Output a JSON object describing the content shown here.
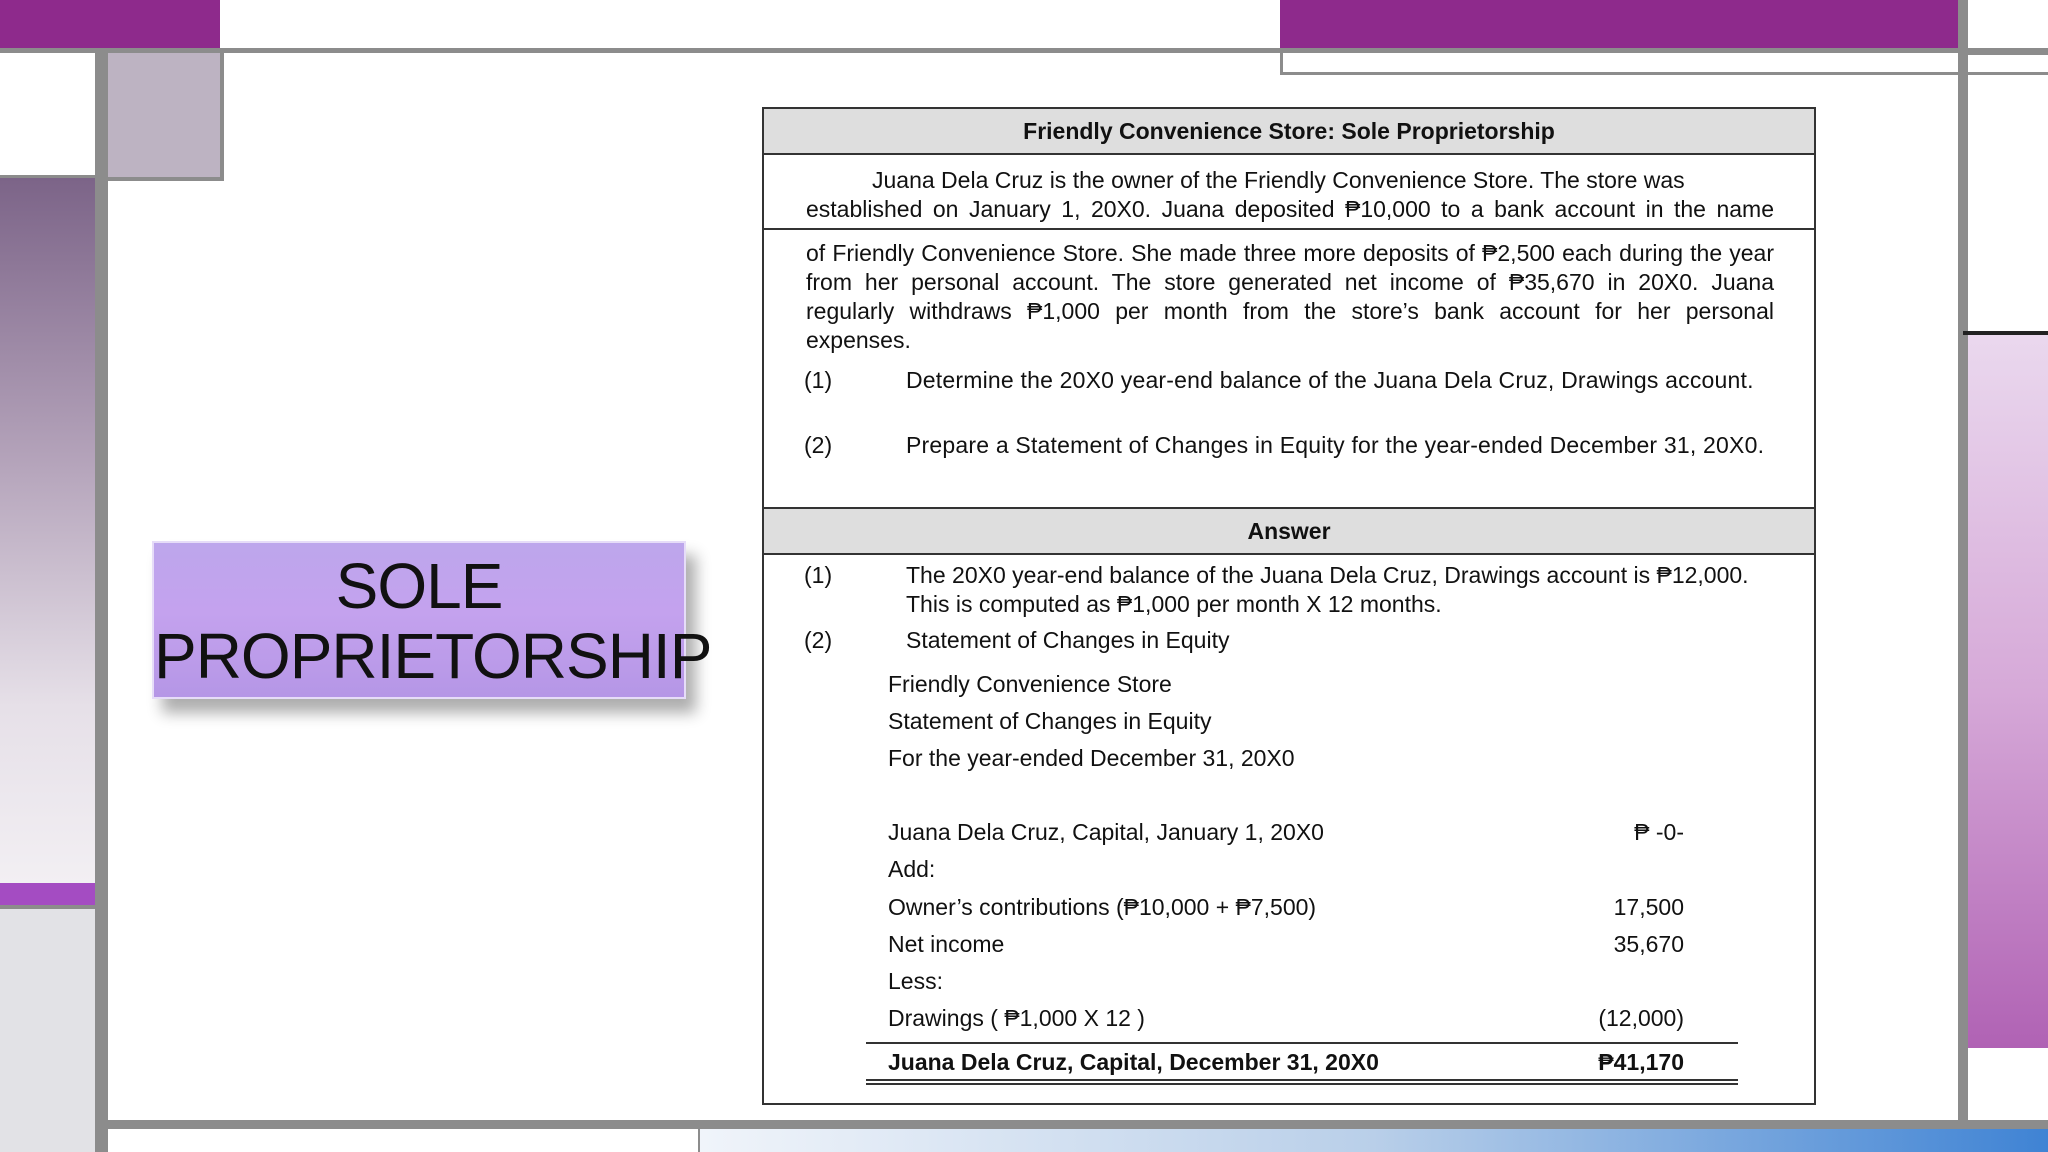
{
  "slide_title": {
    "line1": "SOLE",
    "line2": "PROPRIETORSHIP"
  },
  "document": {
    "header": "Friendly Convenience Store: Sole Proprietorship",
    "intro_line1": "Juana Dela Cruz is the owner of the Friendly Convenience Store. The store was",
    "intro_line2": "established on January 1, 20X0. Juana deposited ₱10,000 to a bank account in the name",
    "intro_rest": "of Friendly Convenience Store. She made three more deposits of ₱2,500 each during the year from her personal account. The store generated net income of ₱35,670 in 20X0. Juana regularly withdraws ₱1,000 per month from the store’s bank account for her personal expenses.",
    "questions": [
      {
        "num": "(1)",
        "text": "Determine the 20X0 year-end balance of the Juana Dela Cruz, Drawings account."
      },
      {
        "num": "(2)",
        "text": "Prepare a Statement of Changes in Equity for the year-ended December 31, 20X0."
      }
    ],
    "answer_header": "Answer",
    "answers": [
      {
        "num": "(1)",
        "text": "The 20X0 year-end balance of the Juana Dela Cruz, Drawings account is ₱12,000. This is computed as ₱1,000 per month X 12 months."
      },
      {
        "num": "(2)",
        "text": "Statement of Changes in Equity"
      }
    ],
    "statement": {
      "company": "Friendly Convenience Store",
      "title": "Statement of Changes in Equity",
      "period": "For the year-ended December 31, 20X0",
      "lines": [
        {
          "label": "Juana Dela Cruz, Capital, January 1, 20X0",
          "amount": "₱ -0-"
        },
        {
          "label": "Add:",
          "amount": ""
        },
        {
          "label": "Owner’s contributions (₱10,000 + ₱7,500)",
          "amount": "17,500"
        },
        {
          "label": "Net income",
          "amount": "35,670"
        },
        {
          "label": "Less:",
          "amount": ""
        },
        {
          "label": "Drawings ( ₱1,000 X 12 )",
          "amount": "(12,000)"
        }
      ],
      "total": {
        "label": "Juana Dela Cruz, Capital, December 31, 20X0",
        "amount": "₱41,170"
      }
    }
  },
  "colors": {
    "accent_purple": "#8e2a8c",
    "title_box": "#c4a2ee",
    "header_gray": "#dedede"
  }
}
